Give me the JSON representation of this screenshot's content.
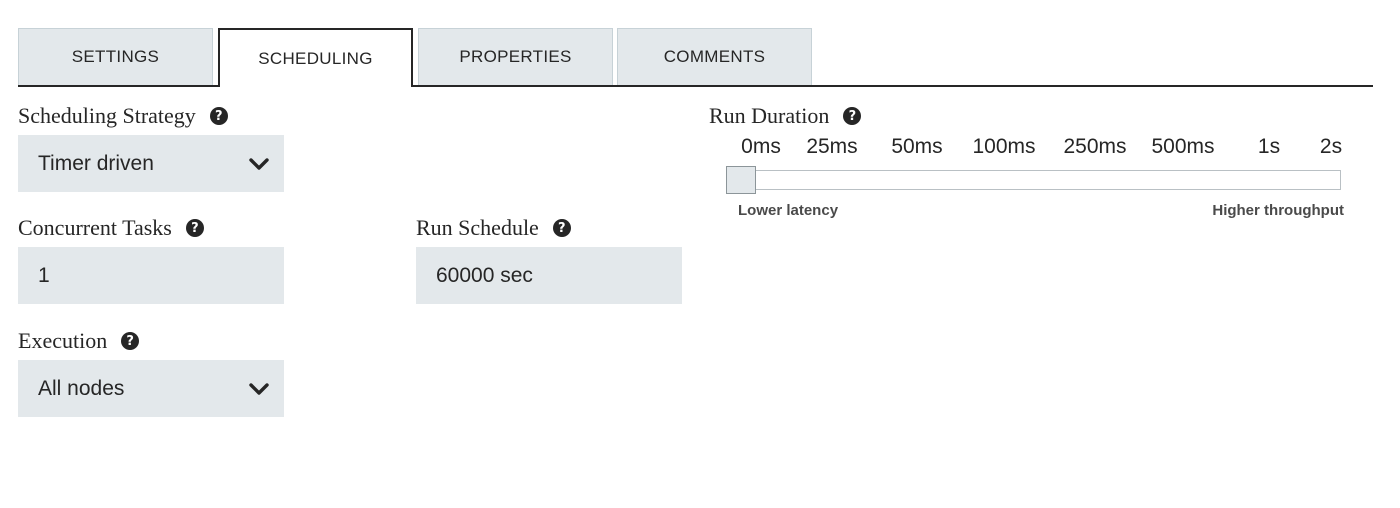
{
  "tabs": [
    {
      "label": "SETTINGS",
      "active": false
    },
    {
      "label": "SCHEDULING",
      "active": true
    },
    {
      "label": "PROPERTIES",
      "active": false
    },
    {
      "label": "COMMENTS",
      "active": false
    }
  ],
  "scheduling_strategy": {
    "label": "Scheduling Strategy",
    "value": "Timer driven",
    "help_icon": "question-circle-icon"
  },
  "concurrent_tasks": {
    "label": "Concurrent Tasks",
    "value": "1",
    "help_icon": "question-circle-icon"
  },
  "run_schedule": {
    "label": "Run Schedule",
    "value": "60000 sec",
    "help_icon": "question-circle-icon"
  },
  "execution": {
    "label": "Execution",
    "value": "All nodes",
    "help_icon": "question-circle-icon"
  },
  "run_duration": {
    "label": "Run Duration",
    "help_icon": "question-circle-icon",
    "ticks": [
      "0ms",
      "25ms",
      "50ms",
      "100ms",
      "250ms",
      "500ms",
      "1s",
      "2s"
    ],
    "selected_index": 0,
    "left_caption": "Lower latency",
    "right_caption": "Higher throughput"
  },
  "colors": {
    "field_background": "#e3e8eb",
    "text": "#262626",
    "active_tab_border": "#262626"
  }
}
